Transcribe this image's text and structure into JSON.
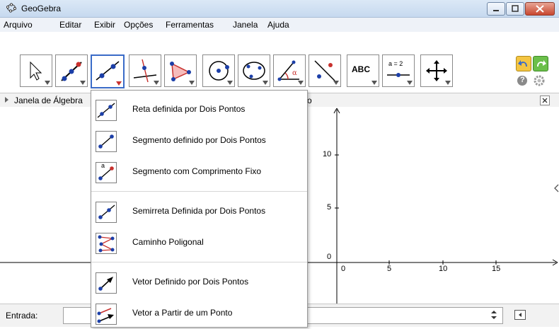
{
  "window": {
    "title": "GeoGebra"
  },
  "menu": [
    "Arquivo",
    "Editar",
    "Exibir",
    "Opções",
    "Ferramentas",
    "Janela",
    "Ajuda"
  ],
  "toolbar": {
    "tools": [
      "move-tool-icon",
      "point-tool-icon",
      "line-tool-icon",
      "perpendicular-line-tool-icon",
      "polygon-tool-icon",
      "circle-tool-icon",
      "conic-tool-icon",
      "angle-tool-icon",
      "reflect-tool-icon",
      "text-tool-icon",
      "slider-tool-icon",
      "move-view-tool-icon"
    ],
    "text_tool_label": "ABC",
    "slider_tool_label": "a = 2"
  },
  "algebra_header": {
    "label": "Janela de Álgebra"
  },
  "graphics": {
    "visible_header_fragment": "o",
    "x_ticks": [
      "0",
      "5",
      "10",
      "15"
    ],
    "y_ticks": [
      "10",
      "5",
      "0"
    ]
  },
  "input_bar": {
    "label": "Entrada:"
  },
  "dropdown": {
    "items": [
      "Reta definida por Dois Pontos",
      "Segmento definido por Dois Pontos",
      "Segmento com Comprimento Fixo",
      "Semirreta Definida por Dois Pontos",
      "Caminho Poligonal",
      "Vetor Definido por Dois Pontos",
      "Vetor a Partir de um Ponto"
    ],
    "fixed_segment_icon_label": "a"
  },
  "colors": {
    "accent": "#3a6bc8",
    "point_blue": "#1c3fa8",
    "point_red": "#c8312e"
  }
}
